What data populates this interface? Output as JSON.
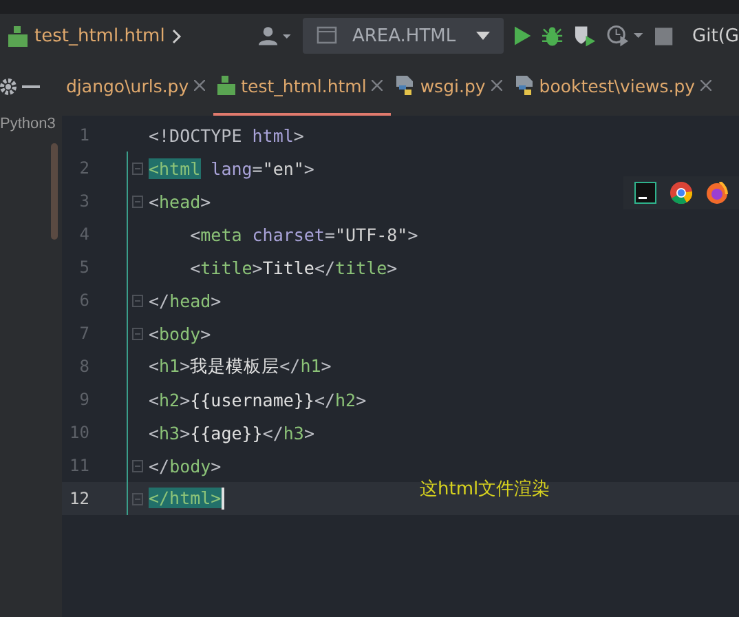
{
  "breadcrumb": {
    "file": "test_html.html"
  },
  "toolbar": {
    "run_config": "AREA.HTML",
    "vcs_label": "Git(G"
  },
  "project_panel": {
    "label": "Python3"
  },
  "tabs": [
    {
      "label": "django\\urls.py",
      "kind": "plain",
      "selected": false
    },
    {
      "label": "test_html.html",
      "kind": "html",
      "selected": true
    },
    {
      "label": "wsgi.py",
      "kind": "python",
      "selected": false
    },
    {
      "label": "booktest\\views.py",
      "kind": "python",
      "selected": false
    }
  ],
  "editor": {
    "lines": [
      {
        "number": "1",
        "current": false,
        "fold": false,
        "tokens": [
          {
            "kind": "punct",
            "text": "<!DOCTYPE "
          },
          {
            "kind": "attr",
            "text": "html"
          },
          {
            "kind": "punct",
            "text": ">"
          }
        ]
      },
      {
        "number": "2",
        "current": false,
        "fold": true,
        "tokens": [
          {
            "kind": "tag",
            "text": "<html",
            "highlighted": true
          },
          {
            "kind": "attr",
            "text": " lang"
          },
          {
            "kind": "punct",
            "text": "="
          },
          {
            "kind": "string",
            "text": "\"en\""
          },
          {
            "kind": "punct",
            "text": ">"
          }
        ]
      },
      {
        "number": "3",
        "current": false,
        "fold": true,
        "tokens": [
          {
            "kind": "punct",
            "text": "<"
          },
          {
            "kind": "tag",
            "text": "head"
          },
          {
            "kind": "punct",
            "text": ">"
          }
        ]
      },
      {
        "number": "4",
        "current": false,
        "fold": false,
        "tokens": [
          {
            "kind": "punct",
            "text": "    <"
          },
          {
            "kind": "tag",
            "text": "meta"
          },
          {
            "kind": "attr",
            "text": " charset"
          },
          {
            "kind": "punct",
            "text": "="
          },
          {
            "kind": "string",
            "text": "\"UTF-8\""
          },
          {
            "kind": "punct",
            "text": ">"
          }
        ]
      },
      {
        "number": "5",
        "current": false,
        "fold": false,
        "tokens": [
          {
            "kind": "punct",
            "text": "    <"
          },
          {
            "kind": "tag",
            "text": "title"
          },
          {
            "kind": "punct",
            "text": ">"
          },
          {
            "kind": "text",
            "text": "Title"
          },
          {
            "kind": "punct",
            "text": "</"
          },
          {
            "kind": "tag",
            "text": "title"
          },
          {
            "kind": "punct",
            "text": ">"
          }
        ]
      },
      {
        "number": "6",
        "current": false,
        "fold": true,
        "tokens": [
          {
            "kind": "punct",
            "text": "</"
          },
          {
            "kind": "tag",
            "text": "head"
          },
          {
            "kind": "punct",
            "text": ">"
          }
        ]
      },
      {
        "number": "7",
        "current": false,
        "fold": true,
        "tokens": [
          {
            "kind": "punct",
            "text": "<"
          },
          {
            "kind": "tag",
            "text": "body"
          },
          {
            "kind": "punct",
            "text": ">"
          }
        ]
      },
      {
        "number": "8",
        "current": false,
        "fold": false,
        "tokens": [
          {
            "kind": "punct",
            "text": "<"
          },
          {
            "kind": "tag",
            "text": "h1"
          },
          {
            "kind": "punct",
            "text": ">"
          },
          {
            "kind": "text",
            "text": "我是模板层"
          },
          {
            "kind": "punct",
            "text": "</"
          },
          {
            "kind": "tag",
            "text": "h1"
          },
          {
            "kind": "punct",
            "text": ">"
          }
        ]
      },
      {
        "number": "9",
        "current": false,
        "fold": false,
        "tokens": [
          {
            "kind": "punct",
            "text": "<"
          },
          {
            "kind": "tag",
            "text": "h2"
          },
          {
            "kind": "punct",
            "text": ">"
          },
          {
            "kind": "text",
            "text": "{{username}}"
          },
          {
            "kind": "punct",
            "text": "</"
          },
          {
            "kind": "tag",
            "text": "h2"
          },
          {
            "kind": "punct",
            "text": ">"
          }
        ]
      },
      {
        "number": "10",
        "current": false,
        "fold": false,
        "tokens": [
          {
            "kind": "punct",
            "text": "<"
          },
          {
            "kind": "tag",
            "text": "h3"
          },
          {
            "kind": "punct",
            "text": ">"
          },
          {
            "kind": "text",
            "text": "{{age}}"
          },
          {
            "kind": "punct",
            "text": "</"
          },
          {
            "kind": "tag",
            "text": "h3"
          },
          {
            "kind": "punct",
            "text": ">"
          }
        ]
      },
      {
        "number": "11",
        "current": false,
        "fold": true,
        "tokens": [
          {
            "kind": "punct",
            "text": "</"
          },
          {
            "kind": "tag",
            "text": "body"
          },
          {
            "kind": "punct",
            "text": ">"
          }
        ]
      },
      {
        "number": "12",
        "current": true,
        "fold": true,
        "tokens": [
          {
            "kind": "tag",
            "text": "</html>",
            "highlighted": true
          }
        ]
      }
    ],
    "annotation": "这html文件渲染"
  }
}
